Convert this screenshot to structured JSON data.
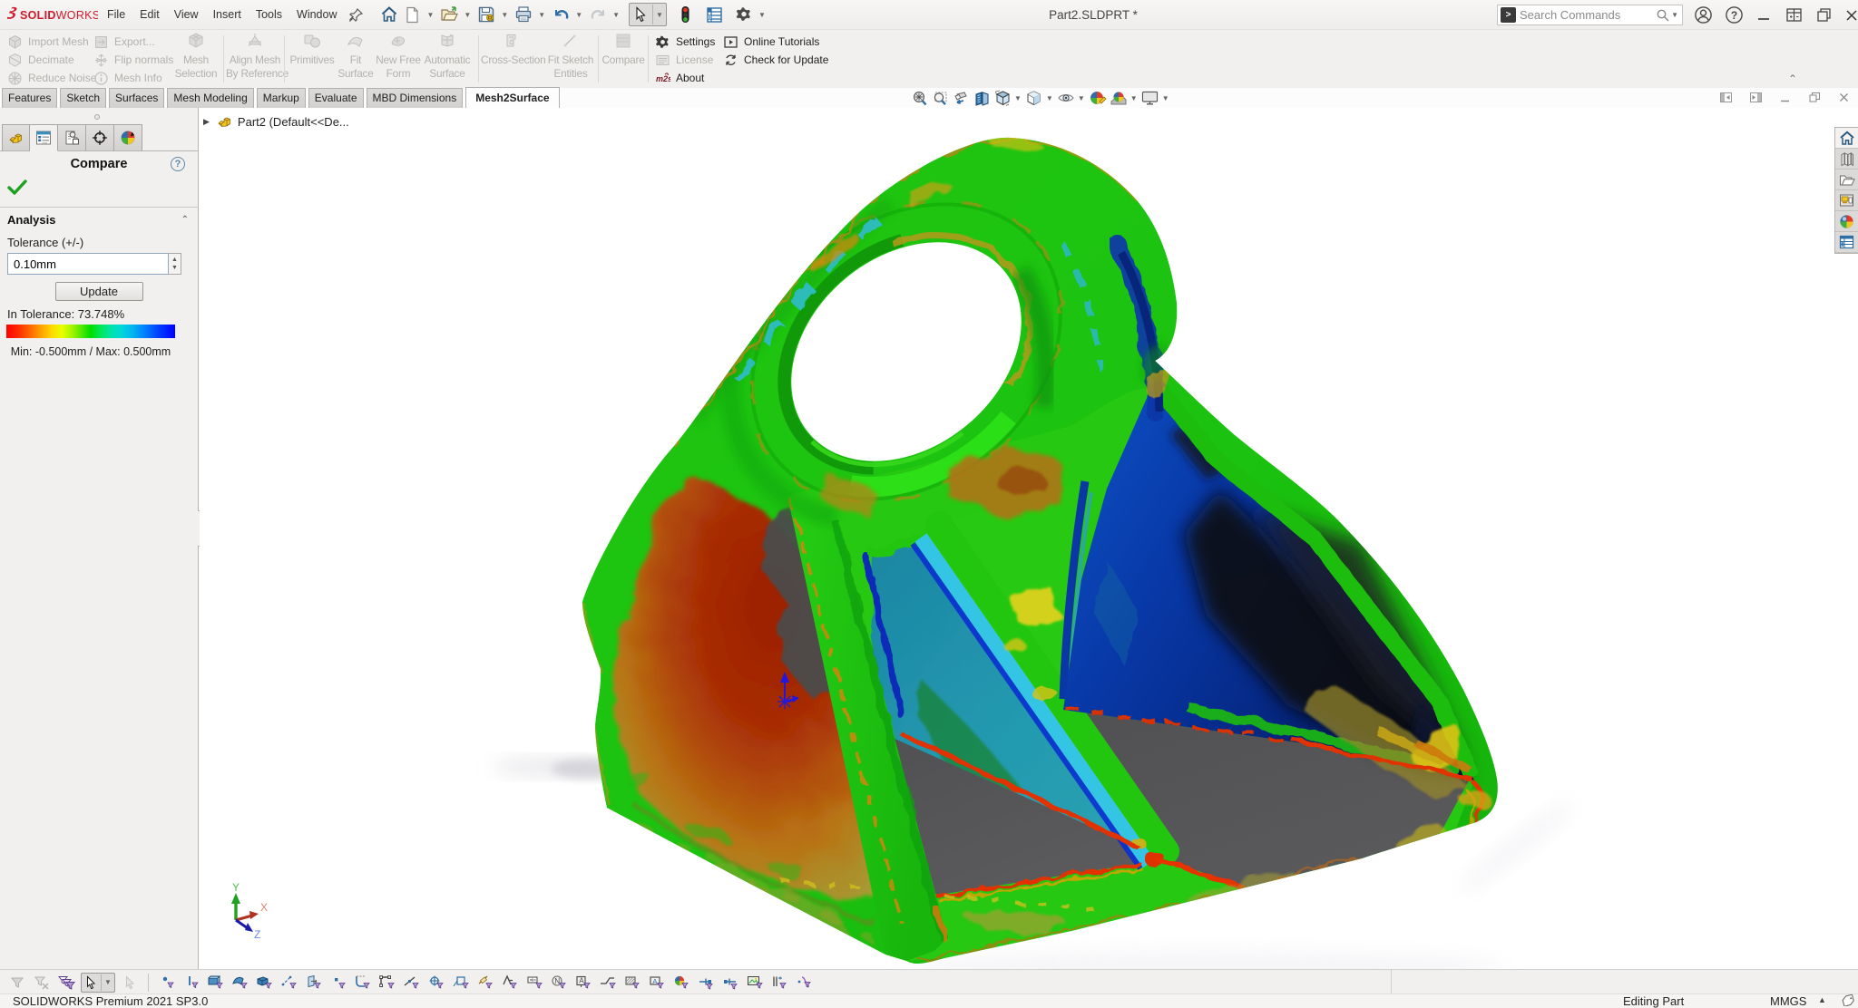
{
  "window": {
    "title": "Part2.SLDPRT *",
    "search_placeholder": "Search Commands"
  },
  "menubar": {
    "brand": {
      "solid": "SOLID",
      "works": "WORKS",
      "color": "#cf1a2b"
    },
    "menus": [
      "File",
      "Edit",
      "View",
      "Insert",
      "Tools",
      "Window"
    ]
  },
  "ribbon": {
    "small_buttons_col1": [
      "Import Mesh",
      "Decimate",
      "Reduce Noise"
    ],
    "small_buttons_col2": [
      "Export...",
      "Flip normals",
      "Mesh Info"
    ],
    "large_buttons": [
      {
        "label1": "Mesh",
        "label2": "Selection"
      },
      {
        "label1": "Align Mesh",
        "label2": "By Reference"
      },
      {
        "label1": "Primitives",
        "label2": ""
      },
      {
        "label1": "Fit",
        "label2": "Surface"
      },
      {
        "label1": "New Free",
        "label2": "Form"
      },
      {
        "label1": "Automatic",
        "label2": "Surface"
      },
      {
        "label1": "Cross-Section",
        "label2": ""
      },
      {
        "label1": "Fit Sketch",
        "label2": "Entities"
      },
      {
        "label1": "Compare",
        "label2": ""
      }
    ],
    "right_buttons": [
      {
        "label": "Settings",
        "enabled": true
      },
      {
        "label": "License",
        "enabled": false
      },
      {
        "label": "About",
        "enabled": true
      },
      {
        "label": "Online Tutorials",
        "enabled": true
      },
      {
        "label": "Check for Update",
        "enabled": true
      }
    ]
  },
  "command_tabs": [
    "Features",
    "Sketch",
    "Surfaces",
    "Mesh Modeling",
    "Markup",
    "Evaluate",
    "MBD Dimensions",
    "Mesh2Surface"
  ],
  "active_tab": "Mesh2Surface",
  "property_panel": {
    "title": "Compare",
    "section": "Analysis",
    "tolerance_label": "Tolerance (+/-)",
    "tolerance_value": "0.10mm",
    "update_button": "Update",
    "in_tolerance": "In Tolerance: 73.748%",
    "scale_minmax": "Min: -0.500mm / Max: 0.500mm",
    "legend_colors": [
      "#ff0000",
      "#ff6600",
      "#ffd900",
      "#4ae800",
      "#00dc00",
      "#00d8d8",
      "#0080ff",
      "#0000ff"
    ]
  },
  "feature_tree": {
    "root": "Part2  (Default<<De..."
  },
  "viewport": {
    "triad_labels": {
      "x": "X",
      "y": "Y",
      "z": "Z"
    },
    "model_colors": {
      "in_tolerance_green": "#17c30d",
      "positive_red": "#a32405",
      "positive_orange": "#bf6a10",
      "olive": "#a89d38",
      "negative_teal": "#2391ad",
      "negative_cyan": "#36c8e8",
      "negative_blue": "#0b3dbb",
      "negative_navy": "#071f7a",
      "no_data_gray": "#575757",
      "yellow": "#ddd21a"
    }
  },
  "statusbar": {
    "left": "SOLIDWORKS Premium 2021 SP3.0",
    "editing": "Editing Part",
    "units": "MMGS"
  }
}
